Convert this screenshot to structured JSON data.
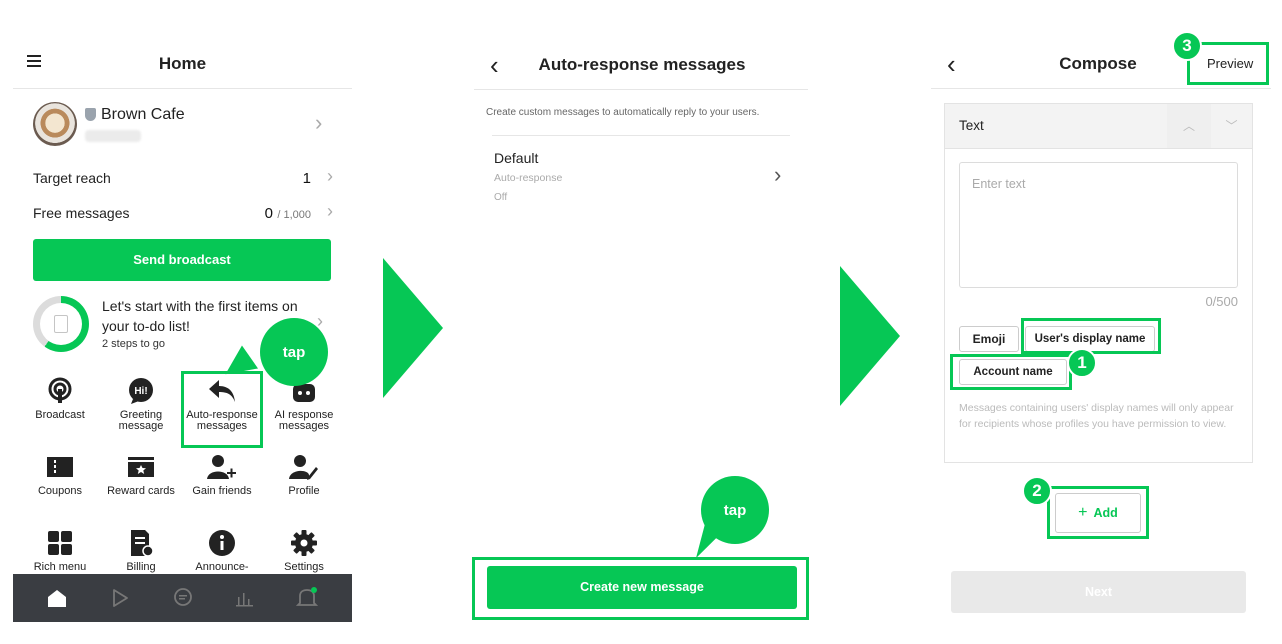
{
  "screen1": {
    "title": "Home",
    "account_name": "Brown Cafe",
    "target_reach_label": "Target reach",
    "target_reach_value": "1",
    "free_messages_label": "Free messages",
    "free_messages_value": "0",
    "free_messages_limit": "/ 1,000",
    "send_broadcast": "Send broadcast",
    "todo_line1": "Let's start with the first items on",
    "todo_line2": "your to-do list!",
    "todo_steps": "2 steps to go",
    "grid": [
      {
        "label": "Broadcast",
        "icon": "broadcast-icon"
      },
      {
        "label": "Greeting message",
        "icon": "greeting-icon"
      },
      {
        "label": "Auto-response messages",
        "icon": "reply-icon"
      },
      {
        "label": "AI response messages",
        "icon": "robot-icon"
      },
      {
        "label": "Coupons",
        "icon": "coupon-icon"
      },
      {
        "label": "Reward cards",
        "icon": "reward-card-icon"
      },
      {
        "label": "Gain friends",
        "icon": "add-friend-icon"
      },
      {
        "label": "Profile",
        "icon": "profile-edit-icon"
      },
      {
        "label": "Rich menu",
        "icon": "grid-icon"
      },
      {
        "label": "Billing",
        "icon": "billing-icon"
      },
      {
        "label": "Announce-",
        "icon": "info-icon"
      },
      {
        "label": "Settings",
        "icon": "gear-icon"
      }
    ],
    "tap_label": "tap",
    "bottom_nav": [
      "home-icon",
      "timeline-icon",
      "chat-icon",
      "insights-icon",
      "notification-icon"
    ]
  },
  "screen2": {
    "title": "Auto-response messages",
    "description": "Create custom messages to automatically reply to your users.",
    "item_title": "Default",
    "item_type": "Auto-response",
    "item_status": "Off",
    "create_button": "Create new message",
    "tap_label": "tap"
  },
  "screen3": {
    "title": "Compose",
    "preview": "Preview",
    "section_label": "Text",
    "text_placeholder": "Enter text",
    "char_count": "0/500",
    "emoji_button": "Emoji",
    "display_name_button": "User's display name",
    "account_name_button": "Account name",
    "note": "Messages containing users' display names will only appear for recipients whose profiles you have permission to view.",
    "add_button": "Add",
    "next_button": "Next",
    "step1": "1",
    "step2": "2",
    "step3": "3"
  },
  "colors": {
    "accent": "#06c755",
    "nav_bar": "#3a3d42"
  }
}
